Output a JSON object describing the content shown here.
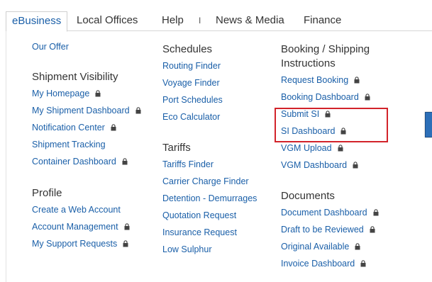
{
  "topnav": {
    "tabs": [
      {
        "label": "eBusiness"
      },
      {
        "label": "Local Offices"
      },
      {
        "label": "Help"
      },
      {
        "label": "News & Media"
      },
      {
        "label": "Finance"
      }
    ],
    "separator": "I"
  },
  "columns": {
    "col1": {
      "our_offer": "Our Offer",
      "shipment_visibility": {
        "heading": "Shipment Visibility",
        "items": [
          "My Homepage",
          "My Shipment Dashboard",
          "Notification Center",
          "Shipment Tracking",
          "Container Dashboard"
        ]
      },
      "profile": {
        "heading": "Profile",
        "items": [
          "Create a Web Account",
          "Account Management",
          "My Support Requests"
        ]
      }
    },
    "col2": {
      "schedules": {
        "heading": "Schedules",
        "items": [
          "Routing Finder",
          "Voyage Finder",
          "Port Schedules",
          "Eco Calculator"
        ]
      },
      "tariffs": {
        "heading": "Tariffs",
        "items": [
          "Tariffs Finder",
          "Carrier Charge Finder",
          "Detention - Demurrages",
          "Quotation Request",
          "Insurance Request",
          "Low Sulphur"
        ]
      }
    },
    "col3": {
      "booking": {
        "heading_line1": "Booking / Shipping",
        "heading_line2": "Instructions",
        "items": [
          "Request Booking",
          "Booking Dashboard",
          "Submit SI",
          "SI Dashboard",
          "VGM Upload",
          "VGM Dashboard"
        ]
      },
      "documents": {
        "heading": "Documents",
        "items": [
          "Document Dashboard",
          "Draft to be Reviewed",
          "Original Available",
          "Invoice Dashboard"
        ]
      }
    }
  },
  "colors": {
    "link": "#1a5fa8",
    "highlight": "#d2232a",
    "text": "#333333"
  }
}
